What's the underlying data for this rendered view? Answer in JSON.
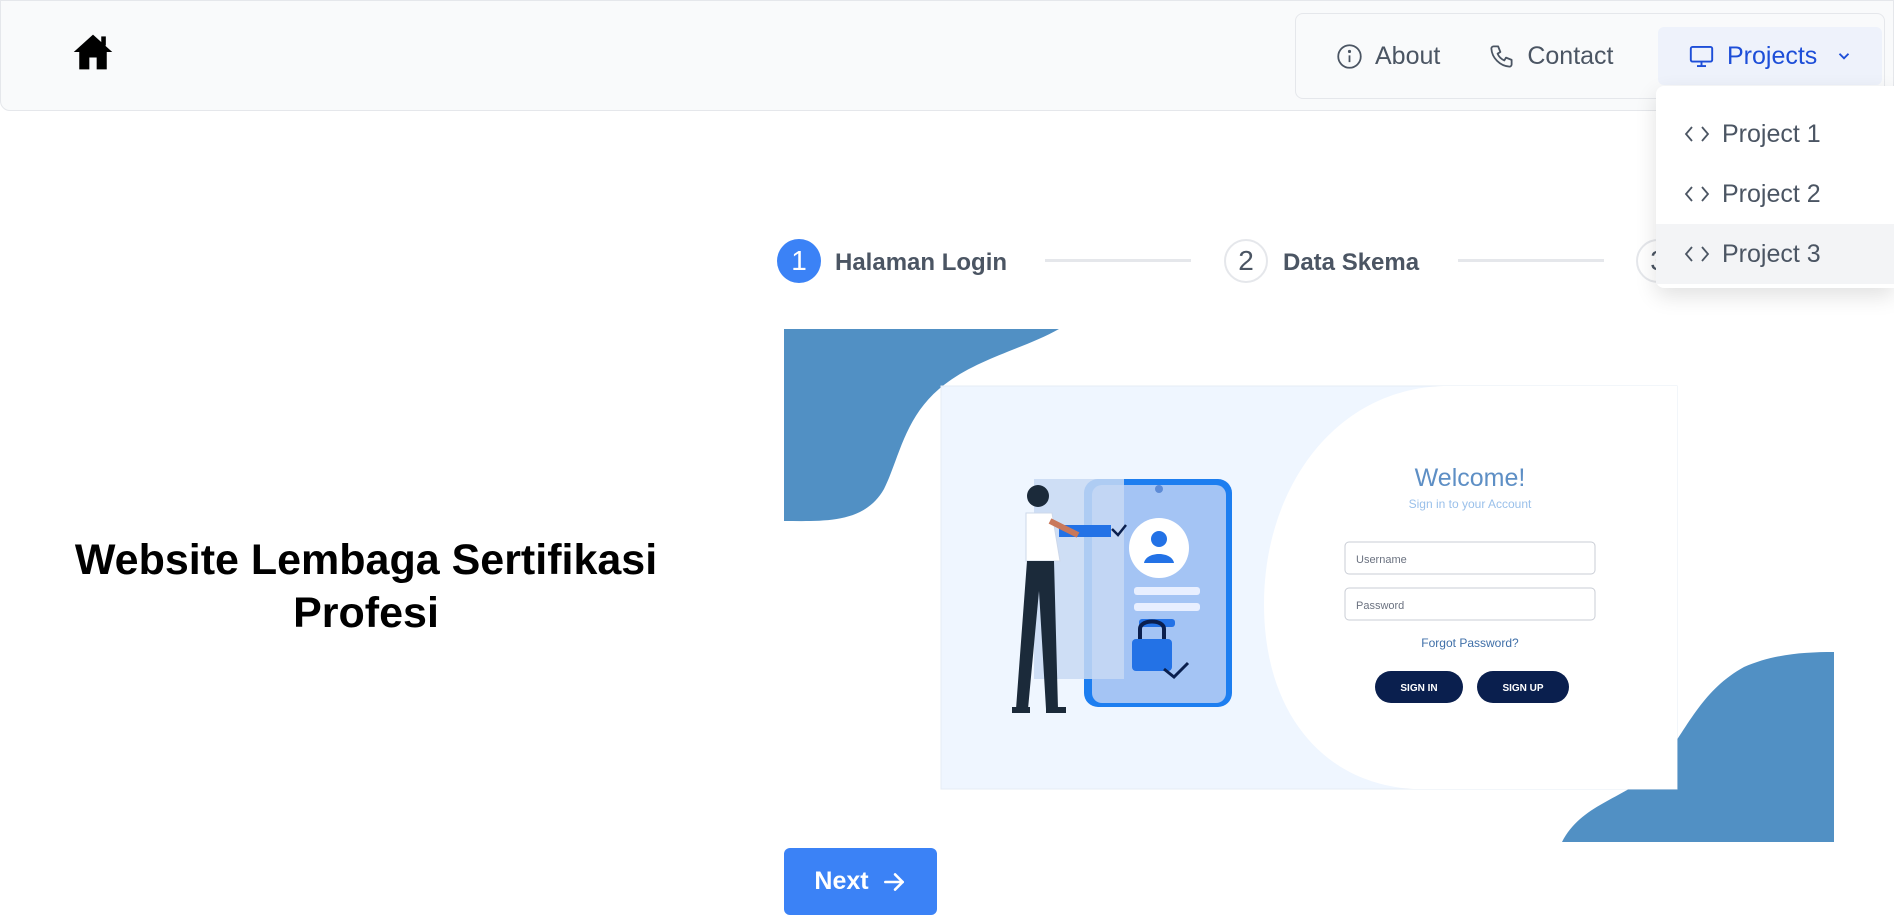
{
  "nav": {
    "items": [
      {
        "label": "About",
        "icon": "info-icon"
      },
      {
        "label": "Contact",
        "icon": "phone-icon"
      },
      {
        "label": "Projects",
        "icon": "monitor-icon",
        "active": true
      }
    ],
    "dropdown": [
      {
        "label": "Project 1",
        "icon": "code-icon"
      },
      {
        "label": "Project 2",
        "icon": "code-icon"
      },
      {
        "label": "Project 3",
        "icon": "code-icon",
        "hovered": true
      }
    ]
  },
  "hero": {
    "title": "Website Lembaga Sertifikasi Profesi"
  },
  "stepper": {
    "steps": [
      {
        "number": "1",
        "label": "Halaman Login",
        "active": true
      },
      {
        "number": "2",
        "label": "Data Skema",
        "active": false
      },
      {
        "number": "3",
        "label": "",
        "active": false
      }
    ]
  },
  "illustration": {
    "welcome": "Welcome!",
    "subtitle": "Sign in to your Account",
    "username_placeholder": "Username",
    "password_placeholder": "Password",
    "forgot": "Forgot Password?",
    "sign_in": "SIGN IN",
    "sign_up": "SIGN UP"
  },
  "actions": {
    "next_label": "Next"
  },
  "colors": {
    "primary": "#3b82f6",
    "active_nav": "#1d4ed8",
    "blob": "#5190c4",
    "illus_dark": "#0a1f4e"
  }
}
